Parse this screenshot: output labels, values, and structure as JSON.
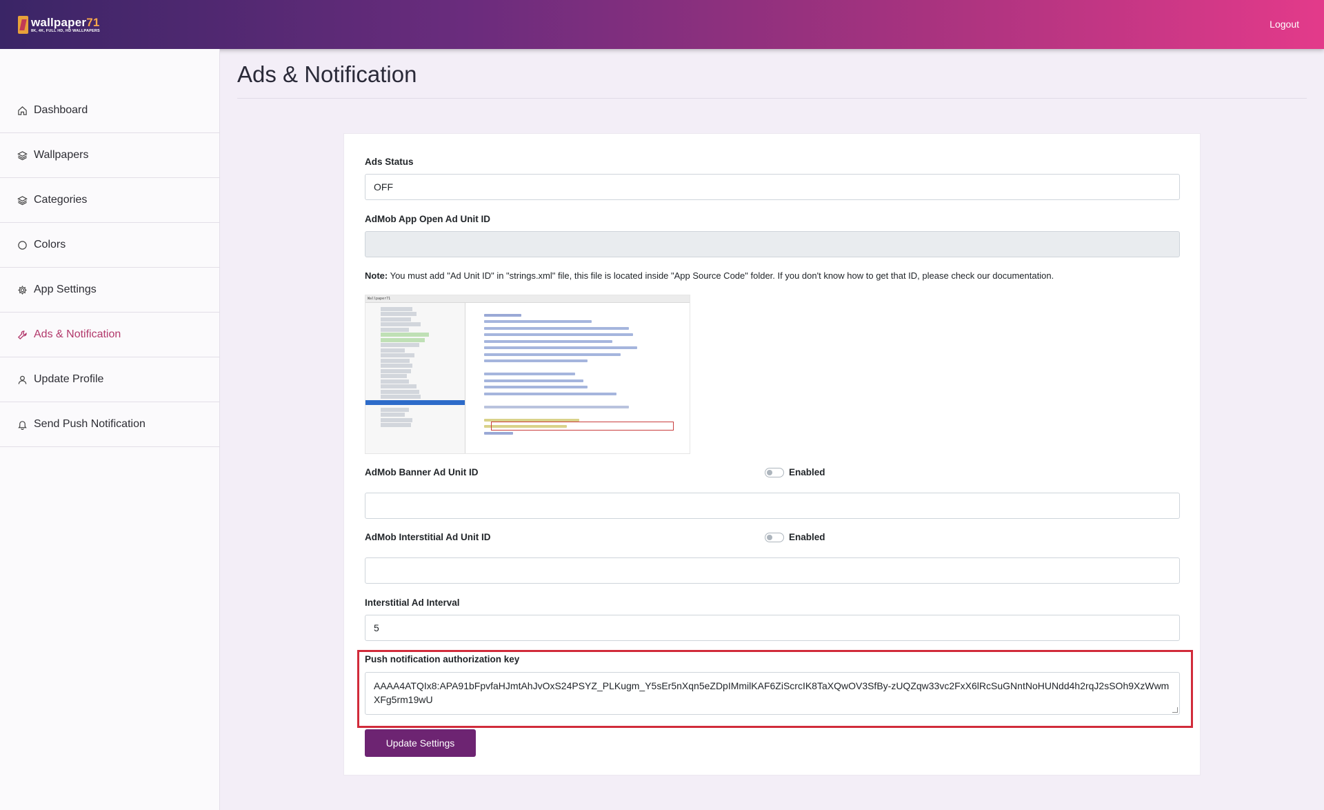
{
  "header": {
    "logo_title": "wallpaper",
    "logo_title_num": "71",
    "logo_subtitle": "8K, 4K, FULL HD, HD WALLPAPERS",
    "logout_label": "Logout",
    "gradient_colors": [
      "#3a2566",
      "#e33a8a"
    ]
  },
  "sidebar": {
    "items": [
      {
        "label": "Dashboard",
        "icon": "home-icon"
      },
      {
        "label": "Wallpapers",
        "icon": "layers-icon"
      },
      {
        "label": "Categories",
        "icon": "layers-icon"
      },
      {
        "label": "Colors",
        "icon": "circle-icon"
      },
      {
        "label": "App Settings",
        "icon": "gear-icon"
      },
      {
        "label": "Ads & Notification",
        "icon": "wrench-icon",
        "active": true
      },
      {
        "label": "Update Profile",
        "icon": "user-icon"
      },
      {
        "label": "Send Push Notification",
        "icon": "bell-icon"
      }
    ],
    "active_color": "#b2386b"
  },
  "page": {
    "title": "Ads & Notification"
  },
  "form": {
    "ads_status_label": "Ads Status",
    "ads_status_value": "OFF",
    "app_open_label": "AdMob App Open Ad Unit ID",
    "app_open_value": "",
    "note_prefix": "Note:",
    "note_text": " You must add \"Ad Unit ID\" in \"strings.xml\" file, this file is located inside \"App Source Code\" folder. If you don't know how to get that ID, please check our documentation.",
    "banner_label": "AdMob Banner Ad Unit ID",
    "banner_toggle_label": "Enabled",
    "banner_enabled": false,
    "banner_value": "",
    "interstitial_label": "AdMob Interstitial Ad Unit ID",
    "interstitial_toggle_label": "Enabled",
    "interstitial_enabled": false,
    "interstitial_value": "",
    "interval_label": "Interstitial Ad Interval",
    "interval_value": "5",
    "push_key_label": "Push notification authorization key",
    "push_key_value": "AAAA4ATQIx8:APA91bFpvfaHJmtAhJvOxS24PSYZ_PLKugm_Y5sEr5nXqn5eZDpIMmilKAF6ZiScrcIK8TaXQwOV3SfBy-zUQZqw33vc2FxX6lRcSuGNntNoHUNdd4h2rqJ2sSOh9XzWwmXFg5rm19wU",
    "submit_label": "Update Settings",
    "highlight_color": "#d12b3a",
    "button_color": "#6d2472"
  },
  "ide_thumbnail": {
    "project_label": "Wallpaper71",
    "icon": "ide-screenshot-image"
  }
}
